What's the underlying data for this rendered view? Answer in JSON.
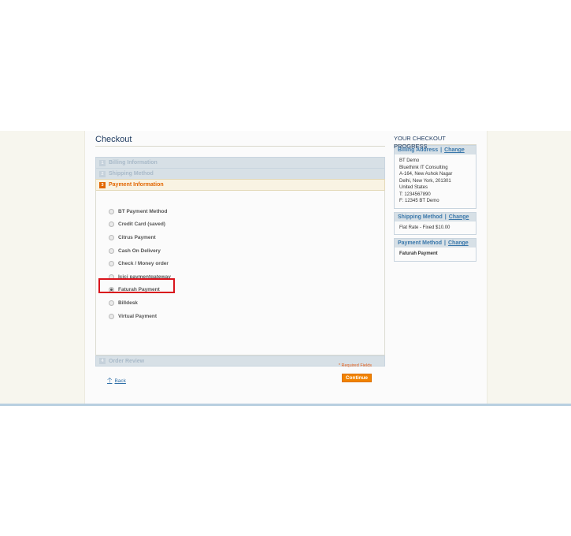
{
  "checkout": {
    "title": "Checkout",
    "steps": [
      {
        "number": "1",
        "label": "Billing Information"
      },
      {
        "number": "2",
        "label": "Shipping Method"
      },
      {
        "number": "3",
        "label": "Payment Information"
      },
      {
        "number": "4",
        "label": "Order Review"
      }
    ],
    "payment_methods": [
      {
        "label": "BT Payment Method",
        "selected": false
      },
      {
        "label": "Credit Card (saved)",
        "selected": false
      },
      {
        "label": "Citrus Payment",
        "selected": false
      },
      {
        "label": "Cash On Delivery",
        "selected": false
      },
      {
        "label": "Check / Money order",
        "selected": false
      },
      {
        "label": "Icici paymentgateway",
        "selected": false
      },
      {
        "label": "Faturah Payment",
        "selected": true
      },
      {
        "label": "Billdesk",
        "selected": false
      },
      {
        "label": "Virtual Payment",
        "selected": false
      }
    ],
    "required_note": "* Required Fields",
    "back_label": "Back",
    "continue_label": "Continue"
  },
  "progress": {
    "title": "YOUR CHECKOUT PROGRESS",
    "change_label": "Change",
    "separator": "|",
    "billing": {
      "heading": "Billing Address",
      "lines": [
        "BT Demo",
        "Bluethink IT Consulting",
        "A-164, New Ashok Nagar",
        "Delhi, New York, 201301",
        "United States",
        "T: 1234567890",
        "F: 12345 BT Demo"
      ]
    },
    "shipping": {
      "heading": "Shipping Method",
      "value": "Flat Rate - Fixed $10.00"
    },
    "payment": {
      "heading": "Payment Method",
      "value": "Faturah Payment"
    }
  },
  "colors": {
    "accent": "#e26703",
    "button": "#f18200",
    "link": "#2f6fa7",
    "highlight": "#d9141c"
  }
}
